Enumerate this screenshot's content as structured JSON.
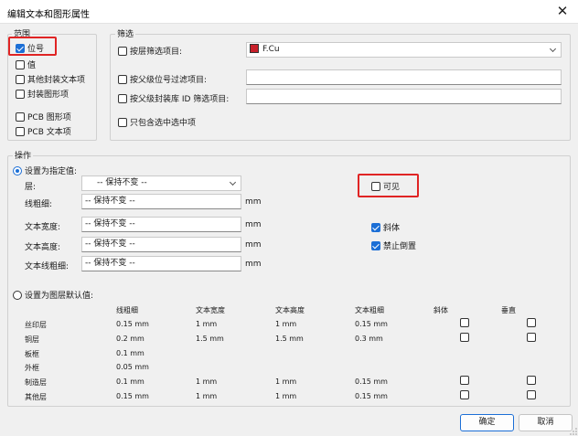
{
  "window": {
    "title": "编辑文本和图形属性",
    "close_glyph": "✕"
  },
  "scope": {
    "label": "范围",
    "items": [
      {
        "label": "位号",
        "checked": true
      },
      {
        "label": "值",
        "checked": false
      },
      {
        "label": "其他封装文本项",
        "checked": false
      },
      {
        "label": "封装图形项",
        "checked": false
      },
      {
        "label": "PCB 图形项",
        "checked": false
      },
      {
        "label": "PCB 文本项",
        "checked": false
      }
    ]
  },
  "filter": {
    "label": "筛选",
    "by_layer": {
      "label": "按层筛选项目:",
      "checked": false,
      "value": "F.Cu",
      "swatch_color": "#c8202a"
    },
    "by_ref": {
      "label": "按父级位号过滤项目:",
      "checked": false,
      "value": ""
    },
    "by_lib_id": {
      "label": "按父级封装库 ID 筛选项目:",
      "checked": false,
      "value": ""
    },
    "selected_only": {
      "label": "只包含选中选中项",
      "checked": false
    }
  },
  "operation": {
    "label": "操作",
    "set_specified": {
      "label": "设置为指定值:",
      "checked": true
    },
    "layer_label": "层:",
    "layer_value": "-- 保持不变 --",
    "line_width_label": "线粗细:",
    "line_width_value": "-- 保持不变 --",
    "text_width_label": "文本宽度:",
    "text_width_value": "-- 保持不变 --",
    "text_height_label": "文本高度:",
    "text_height_value": "-- 保持不变 --",
    "text_thickness_label": "文本线粗细:",
    "text_thickness_value": "-- 保持不变 --",
    "unit": "mm",
    "visible": {
      "label": "可见",
      "checked": false
    },
    "italic": {
      "label": "斜体",
      "checked": true
    },
    "keep_upright": {
      "label": "禁止倒置",
      "checked": true
    },
    "set_defaults": {
      "label": "设置为图层默认值:",
      "checked": false
    }
  },
  "defaults_table": {
    "headers": [
      "线粗细",
      "文本宽度",
      "文本高度",
      "文本粗细",
      "斜体",
      "垂直"
    ],
    "rows": [
      {
        "name": "丝印层",
        "line": "0.15 mm",
        "tw": "1 mm",
        "th": "1 mm",
        "tt": "0.15 mm",
        "cb": true
      },
      {
        "name": "铜层",
        "line": "0.2 mm",
        "tw": "1.5 mm",
        "th": "1.5 mm",
        "tt": "0.3 mm",
        "cb": true
      },
      {
        "name": "板框",
        "line": "0.1 mm",
        "tw": "",
        "th": "",
        "tt": "",
        "cb": false
      },
      {
        "name": "外框",
        "line": "0.05 mm",
        "tw": "",
        "th": "",
        "tt": "",
        "cb": false
      },
      {
        "name": "制造层",
        "line": "0.1 mm",
        "tw": "1 mm",
        "th": "1 mm",
        "tt": "0.15 mm",
        "cb": true
      },
      {
        "name": "其他层",
        "line": "0.15 mm",
        "tw": "1 mm",
        "th": "1 mm",
        "tt": "0.15 mm",
        "cb": true
      }
    ]
  },
  "buttons": {
    "ok": "确定",
    "cancel": "取消"
  },
  "highlight_color": "#e02424",
  "accent_color": "#1c6fd6"
}
